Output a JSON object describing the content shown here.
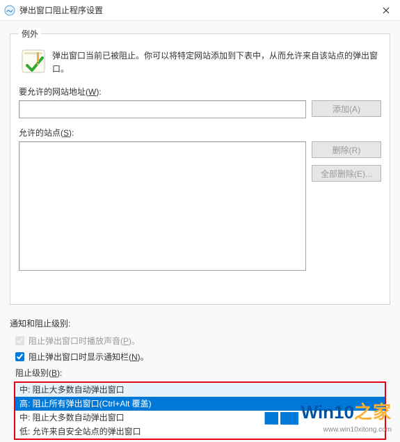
{
  "window": {
    "title": "弹出窗口阻止程序设置"
  },
  "exceptions": {
    "legend": "例外",
    "description": "弹出窗口当前已被阻止。你可以将特定网站添加到下表中，从而允许来自该站点的弹出窗口。",
    "allow_label_pre": "要允许的网站地址(",
    "allow_label_key": "W",
    "allow_label_post": "):",
    "add_button": "添加(A)",
    "sites_label_pre": "允许的站点(",
    "sites_label_key": "S",
    "sites_label_post": "):",
    "remove_button": "删除(R)",
    "remove_all_button": "全部删除(E)..."
  },
  "notify": {
    "title": "通知和阻止级别:",
    "sound_label_pre": "阻止弹出窗口时播放声音(",
    "sound_label_key": "P",
    "sound_label_post": ")。",
    "bar_label_pre": "阻止弹出窗口时显示通知栏(",
    "bar_label_key": "N",
    "bar_label_post": ")。",
    "level_label_pre": "阻止级别(",
    "level_label_key": "B",
    "level_label_post": "):",
    "options": [
      "中: 阻止大多数自动弹出窗口",
      "高: 阻止所有弹出窗口(Ctrl+Alt 覆盖)",
      "中: 阻止大多数自动弹出窗口",
      "低: 允许来自安全站点的弹出窗口"
    ]
  },
  "watermark": {
    "main": "Win10",
    "sub": "之家",
    "url": "www.win10xitong.com"
  }
}
